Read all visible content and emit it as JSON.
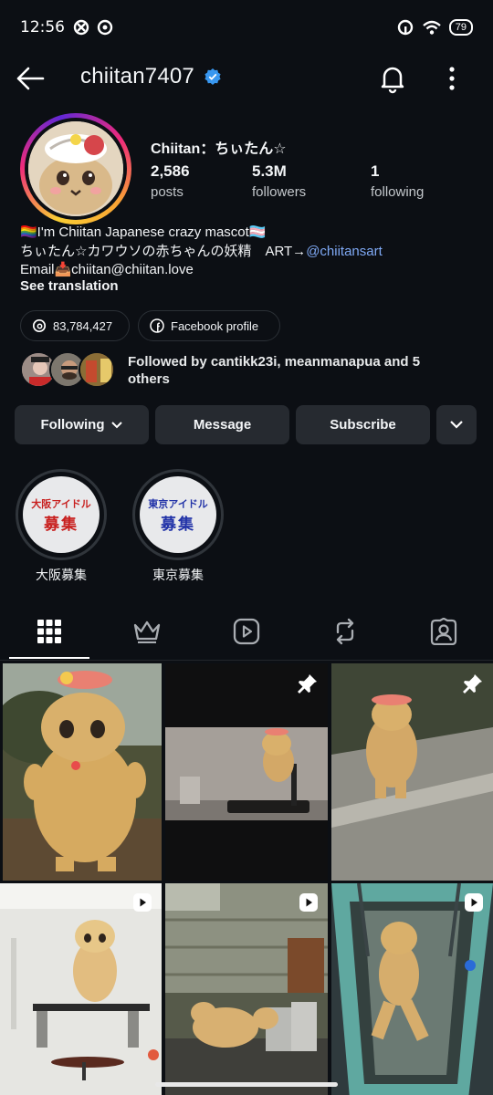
{
  "status_bar": {
    "time": "12:56",
    "battery": "79"
  },
  "header": {
    "username": "chiitan7407"
  },
  "profile": {
    "display_name": "Chiitan：ちぃたん☆",
    "stats": [
      {
        "value": "2,586",
        "label": "posts"
      },
      {
        "value": "5.3M",
        "label": "followers"
      },
      {
        "value": "1",
        "label": "following"
      }
    ],
    "bio_line1": "🏳️‍🌈I'm Chiitan Japanese crazy mascot🏳️‍⚧️",
    "bio_line2": "ちぃたん☆カワウソの赤ちゃんの妖精　ART→",
    "bio_link": "@chiitansart",
    "bio_line3": "Email📥chiitan@chiitan.love",
    "see_translation": "See translation",
    "threads_count": "83,784,427",
    "facebook_label": "Facebook profile",
    "followed_by": "Followed by cantikk23i, meanmanapua and 5 others"
  },
  "actions": {
    "following": "Following",
    "message": "Message",
    "subscribe": "Subscribe"
  },
  "highlights": [
    {
      "line1": "大阪アイドル",
      "line2": "募集",
      "label": "大阪募集"
    },
    {
      "line1": "東京アイドル",
      "line2": "募集",
      "label": "東京募集"
    }
  ],
  "tabs": [
    "grid-icon",
    "crown-icon",
    "reels-icon",
    "reposts-icon",
    "tagged-icon"
  ],
  "grid": [
    {
      "type": "image",
      "pinned": false,
      "bg": "#6b6a48"
    },
    {
      "type": "image",
      "pinned": true,
      "bg": "#111111"
    },
    {
      "type": "image",
      "pinned": true,
      "bg": "#7b7c6e"
    },
    {
      "type": "reel",
      "pinned": false,
      "bg": "#d9d9d6"
    },
    {
      "type": "reel",
      "pinned": false,
      "bg": "#6f6a57"
    },
    {
      "type": "reel",
      "pinned": false,
      "bg": "#3f6a72"
    }
  ]
}
